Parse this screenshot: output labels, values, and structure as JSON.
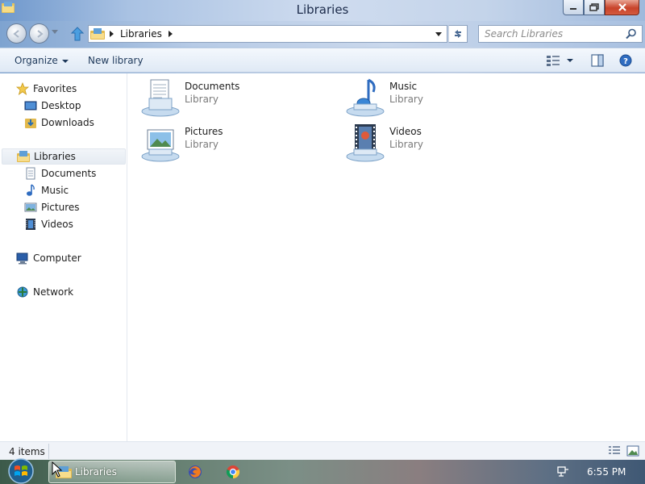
{
  "window": {
    "title": "Libraries"
  },
  "address": {
    "crumbs": [
      "Libraries"
    ]
  },
  "search": {
    "placeholder": "Search Libraries"
  },
  "commands": {
    "organize": "Organize",
    "new_library": "New library"
  },
  "sidebar": {
    "favorites": {
      "label": "Favorites",
      "items": [
        {
          "label": "Desktop",
          "icon": "desktop-icon"
        },
        {
          "label": "Downloads",
          "icon": "downloads-folder-icon"
        }
      ]
    },
    "libraries": {
      "label": "Libraries",
      "items": [
        {
          "label": "Documents",
          "icon": "documents-icon"
        },
        {
          "label": "Music",
          "icon": "music-icon"
        },
        {
          "label": "Pictures",
          "icon": "pictures-icon"
        },
        {
          "label": "Videos",
          "icon": "videos-icon"
        }
      ]
    },
    "computer": {
      "label": "Computer",
      "icon": "computer-icon"
    },
    "network": {
      "label": "Network",
      "icon": "network-icon"
    }
  },
  "libraries": [
    {
      "name": "Documents",
      "kind": "Library",
      "icon": "documents-library-icon"
    },
    {
      "name": "Music",
      "kind": "Library",
      "icon": "music-library-icon"
    },
    {
      "name": "Pictures",
      "kind": "Library",
      "icon": "pictures-library-icon"
    },
    {
      "name": "Videos",
      "kind": "Library",
      "icon": "videos-library-icon"
    }
  ],
  "status": {
    "item_count": "4 items"
  },
  "taskbar": {
    "active_window": "Libraries",
    "clock": "6:55 PM"
  },
  "colors": {
    "selection": "#e5ebf2",
    "accent": "#1e395b",
    "title_text": "#1c2b4a"
  }
}
